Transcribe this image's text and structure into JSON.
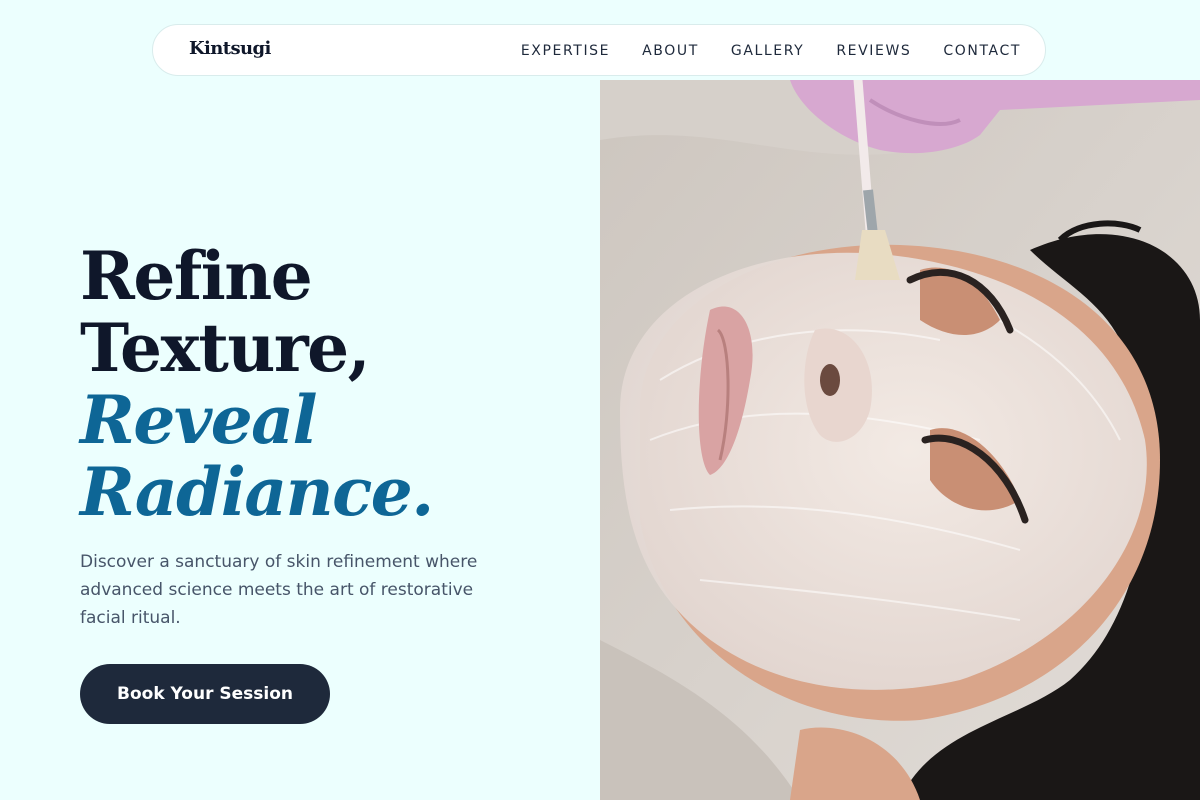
{
  "nav": {
    "logo": "Kintsugi",
    "links": [
      "EXPERTISE",
      "ABOUT",
      "GALLERY",
      "REVIEWS",
      "CONTACT"
    ]
  },
  "hero": {
    "headline": {
      "line1": "Refine",
      "line2": "Texture,",
      "accent1": "Reveal",
      "accent2": "Radiance."
    },
    "description": "Discover a sanctuary of skin refinement where advanced science meets the art of restorative facial ritual.",
    "cta_label": "Book Your Session",
    "image_alt": "Woman receiving a facial mask applied with a brush"
  },
  "colors": {
    "background": "#ecfffe",
    "heading": "#0f172a",
    "accent": "#0e6696",
    "body_text": "#475569",
    "button": "#1e293b"
  }
}
